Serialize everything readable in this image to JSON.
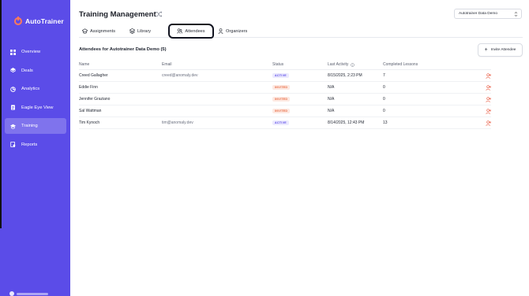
{
  "app": {
    "name": "AutoTrainer"
  },
  "sidebar": {
    "items": [
      {
        "label": "Overview",
        "icon": "grid-icon",
        "active": false
      },
      {
        "label": "Deals",
        "icon": "layers-icon",
        "active": false
      },
      {
        "label": "Analytics",
        "icon": "analytics-icon",
        "active": false
      },
      {
        "label": "Eagle Eye View",
        "icon": "document-icon",
        "active": false
      },
      {
        "label": "Training",
        "icon": "graduation-cap-icon",
        "active": true
      },
      {
        "label": "Reports",
        "icon": "report-icon",
        "active": false
      }
    ]
  },
  "header": {
    "title": "Training Management",
    "org_select": "Autotrainer Data Demo"
  },
  "tabs": [
    {
      "label": "Assignments",
      "icon": "graduation-cap-icon"
    },
    {
      "label": "Library",
      "icon": "layers-icon"
    },
    {
      "label": "Attendees",
      "icon": "users-icon",
      "active": true
    },
    {
      "label": "Organizers",
      "icon": "user-icon"
    }
  ],
  "attendees": {
    "title": "Attendees for Autotrainer Data Demo (5)",
    "invite_label": "Invite Attendee",
    "columns": [
      "Name",
      "Email",
      "Status",
      "Last Activity",
      "Completed Lessons"
    ],
    "rows": [
      {
        "name": "Creed Gallagher",
        "email": "creed@anomaly.dev",
        "status": "ACTIVE",
        "last_activity": "8/15/2025, 2:23 PM",
        "completed": "7"
      },
      {
        "name": "Eddie Finn",
        "email": "",
        "status": "INVITED",
        "last_activity": "N/A",
        "completed": "0"
      },
      {
        "name": "Jennifer Graziano",
        "email": "",
        "status": "INVITED",
        "last_activity": "N/A",
        "completed": "0"
      },
      {
        "name": "Sal Wattman",
        "email": "",
        "status": "INVITED",
        "last_activity": "N/A",
        "completed": "0"
      },
      {
        "name": "Tim Kynoch",
        "email": "tim@anomaly.dev",
        "status": "ACTIVE",
        "last_activity": "8/14/2025, 12:43 PM",
        "completed": "13"
      }
    ]
  },
  "colors": {
    "sidebar_bg": "#5b4ce8",
    "brand_accent": "#ff7a5a",
    "active_badge": "#5b4ce8",
    "invited_badge": "#e8653c",
    "remove_icon": "#e8553c"
  }
}
